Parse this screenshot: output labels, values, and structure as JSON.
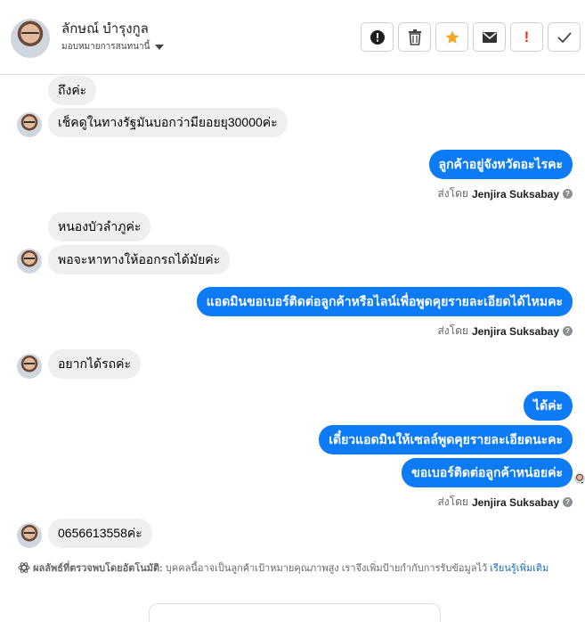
{
  "contact": {
    "name": "ลักษณ์ บำรุงกูล",
    "assign_label": "มอบหมายการสนทนานี้"
  },
  "toolbar": {
    "icons": [
      "alert-circle-icon",
      "trash-icon",
      "star-icon",
      "envelope-icon",
      "exclamation-icon",
      "check-icon"
    ],
    "colors": {
      "star": "#f5a623",
      "exclamation": "#e0322f"
    }
  },
  "messages": [
    {
      "dir": "in",
      "text": "ถึงค่ะ"
    },
    {
      "dir": "in",
      "text": "เช็คดูในทางรัฐมันบอกว่ามียอยยุ30000ค่ะ"
    },
    {
      "dir": "out",
      "text": "ลูกค้าอยู่จังหวัดอะไรคะ"
    },
    {
      "dir": "in",
      "text": "หนองบัวลำภูค่ะ"
    },
    {
      "dir": "in",
      "text": "พอจะหาทางให้ออกรถได้มัยค่ะ"
    },
    {
      "dir": "out",
      "text": "แอดมินขอเบอร์ติดต่อลูกค้าหรือไลน์เพื่อพูดคุยรายละเอียดได้ไหมคะ"
    },
    {
      "dir": "in",
      "text": "อยากได้รถค่ะ"
    },
    {
      "dir": "out",
      "text": "ได้ค่ะ"
    },
    {
      "dir": "out",
      "text": "เดี๋ยวแอดมินให้เซลล์พูดคุยรายละเอียดนะคะ"
    },
    {
      "dir": "out",
      "text": "ขอเบอร์ติดต่อลูกค้าหน่อยค่ะ"
    },
    {
      "dir": "in",
      "text": "0656613558ค่ะ"
    }
  ],
  "sent_by": {
    "prefix": "ส่งโดย",
    "agent": "Jenjira Suksabay"
  },
  "auto_detect": {
    "label": "ผลลัพธ์ที่ตรวจพบโดยอัตโนมัติ:",
    "text": "บุคคลนี้อาจเป็นลูกค้าเป้าหมายคุณภาพสูง เราจึงเพิ่มป้ายกำกับการรับข้อมูลไว้",
    "link": "เรียนรู้เพิ่มเติม"
  },
  "colors": {
    "outgoing_bubble": "#0e7bf6",
    "incoming_bubble": "#efefef"
  }
}
